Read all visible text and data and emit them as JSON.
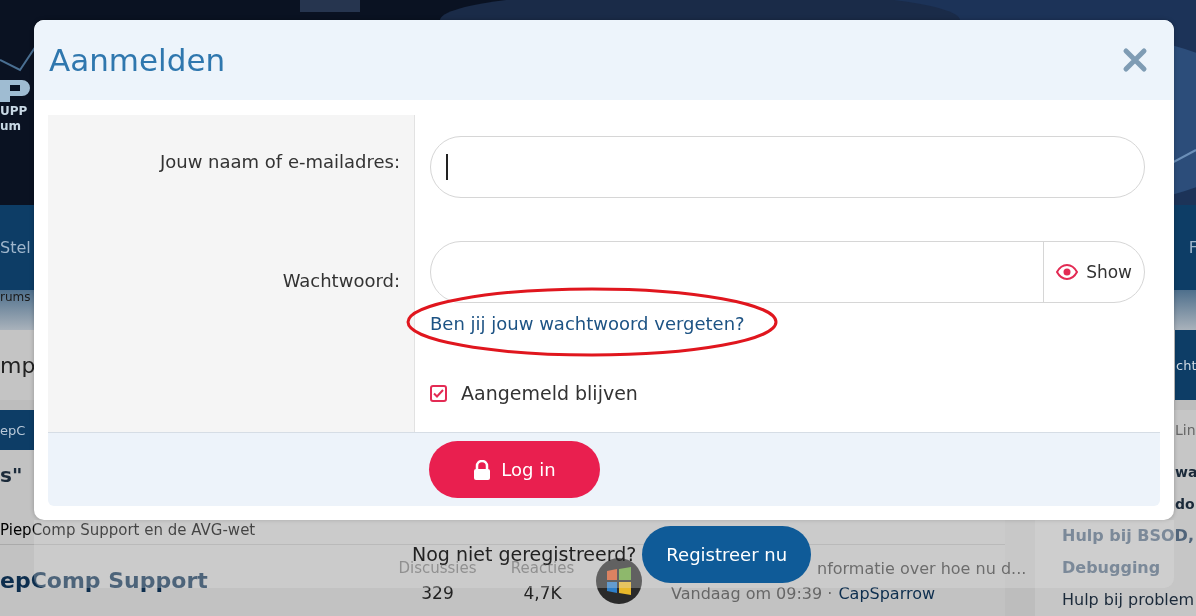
{
  "forum_background": {
    "logo": [
      "UPP",
      "um"
    ],
    "nav": {
      "left": "Stel",
      "right": "F"
    },
    "breadcrumb": "rums",
    "page_title": "mp",
    "header_button": "cht",
    "category_bar": "epC",
    "thread_title": "s\"",
    "thread_subtitle": "PiepComp Support en de AVG-wet",
    "forum_row": {
      "title": "epComp Support",
      "stats": [
        {
          "label": "Discussies",
          "value": "329"
        },
        {
          "label": "Reacties",
          "value": "4,7K"
        }
      ],
      "latest_title": "nformatie over hoe nu d...",
      "latest_meta": "Vandaag om 09:39 ·",
      "latest_user": "CapSparrow"
    },
    "sidebar": {
      "top_fragments": [
        {
          "text": "Lin",
          "kind": "heading"
        },
        {
          "text": "wa",
          "kind": "link"
        },
        {
          "text": "do",
          "kind": "link"
        }
      ],
      "items": [
        {
          "text": "Hulp bij BSOD,",
          "kind": "link"
        },
        {
          "text": "Debugging",
          "kind": "link"
        },
        {
          "text": "Hulp bij problem",
          "kind": "text"
        }
      ]
    }
  },
  "dialog": {
    "title": "Aanmelden",
    "fields": [
      {
        "label": "Jouw naam of e-mailadres:",
        "focused": true
      },
      {
        "label": "Wachtwoord:",
        "focused": false,
        "toggle": "Show"
      }
    ],
    "forgot_link": "Ben jij jouw wachtwoord vergeten?",
    "remember": {
      "label": "Aangemeld blijven",
      "checked": true
    },
    "submit": "Log in"
  },
  "register": {
    "prompt": "Nog niet geregistreerd?",
    "button": "Registreer nu"
  }
}
